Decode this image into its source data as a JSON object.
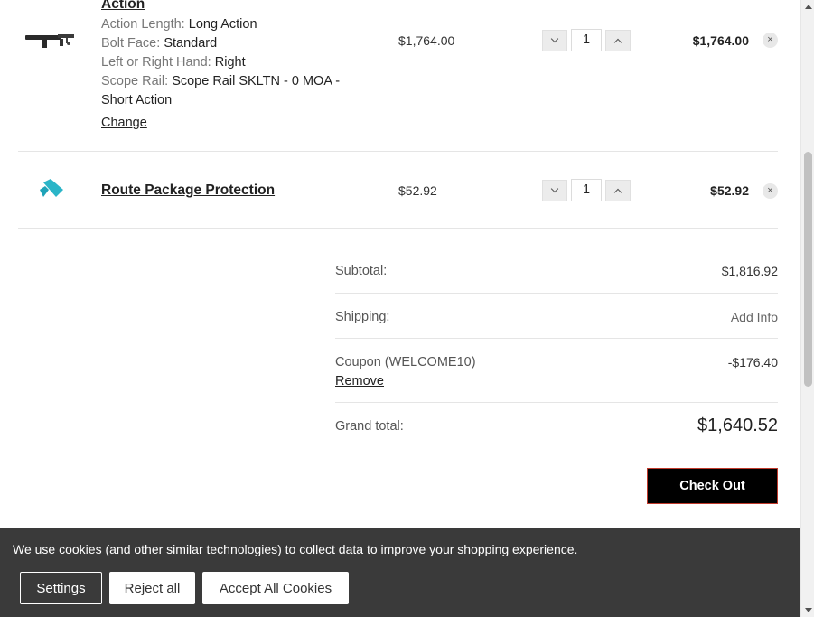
{
  "cart": {
    "items": [
      {
        "title": "Action",
        "options": [
          {
            "label": "Action Length:",
            "value": "Long Action"
          },
          {
            "label": "Bolt Face:",
            "value": "Standard"
          },
          {
            "label": "Left or Right Hand:",
            "value": "Right"
          },
          {
            "label": "Scope Rail:",
            "value": "Scope Rail SKLTN - 0 MOA - Short Action"
          }
        ],
        "change_label": "Change",
        "unit_price": "$1,764.00",
        "quantity": "1",
        "line_total": "$1,764.00",
        "thumb_icon": "rifle-action-image"
      },
      {
        "title": "Route Package Protection",
        "unit_price": "$52.92",
        "quantity": "1",
        "line_total": "$52.92",
        "thumb_icon": "route-logo-image"
      }
    ],
    "remove_glyph": "×"
  },
  "totals": {
    "subtotal_label": "Subtotal:",
    "subtotal_value": "$1,816.92",
    "shipping_label": "Shipping:",
    "shipping_value": "Add Info",
    "coupon_label": "Coupon (WELCOME10)",
    "coupon_value": "-$176.40",
    "coupon_remove": "Remove",
    "grand_label": "Grand total:",
    "grand_value": "$1,640.52"
  },
  "checkout_label": "Check Out",
  "cookie": {
    "message": "We use cookies (and other similar technologies) to collect data to improve your shopping experience.",
    "settings_label": "Settings",
    "reject_label": "Reject all",
    "accept_label": "Accept All Cookies"
  },
  "colors": {
    "accent_logo": "#2bb5c8",
    "banner_bg": "#3a3a3a",
    "button_bg": "#000000"
  }
}
